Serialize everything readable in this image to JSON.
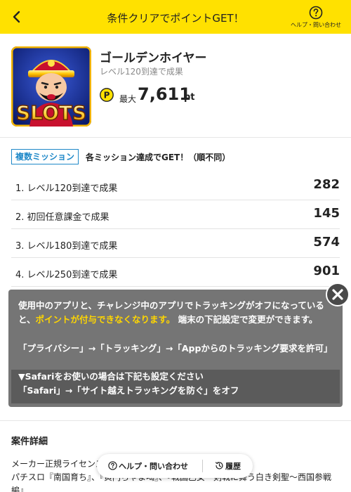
{
  "header": {
    "title": "条件クリアでポイントGET！",
    "help_label": "ヘルプ・問い合わせ",
    "back_icon": "chevron-left-icon",
    "help_icon": "question-circle-icon",
    "background": "#ffe100"
  },
  "app": {
    "icon_text": "SLOTS",
    "name": "ゴールデンホイヤー",
    "subtitle": "レベル120到達で成果",
    "max_label": "最大",
    "max_points": "7,611",
    "points_unit": "pt"
  },
  "missions": {
    "badge": "複数ミッション",
    "description": "各ミッション達成でGET！（順不同）",
    "items": [
      {
        "label": "1. レベル120到達で成果",
        "points": "282"
      },
      {
        "label": "2. 初回任意課金で成果",
        "points": "145"
      },
      {
        "label": "3. レベル180到達で成果",
        "points": "574"
      },
      {
        "label": "4. レベル250到達で成果",
        "points": "901"
      }
    ]
  },
  "overlay": {
    "line1": "使用中のアプリと、チャレンジ中のアプリでトラッキングがオフになっていると、",
    "highlight": "ポイントが付与できなくなります。",
    "line1_end": "端末の下記設定で変更ができます。",
    "path1": "「プライバシー」→「トラッキング」→「Appからのトラッキング要求を許可」",
    "safari_title": "▼Safariをお使いの場合は下記も設定ください",
    "safari_path": "「Safari」→「サイト越えトラッキングを防ぐ」をオフ",
    "close_icon": "close-icon"
  },
  "details": {
    "title": "案件詳細",
    "line1": "メーカー正規ライセンス",
    "line2": "パチスロ『南国育ち』、『黄門ちゃま喝』、『戦国乙女〜剣戟に舞う白き剣聖〜西国参戦編』"
  },
  "float_nav": {
    "help": "ヘルプ・問い合わせ",
    "history": "履歴"
  }
}
